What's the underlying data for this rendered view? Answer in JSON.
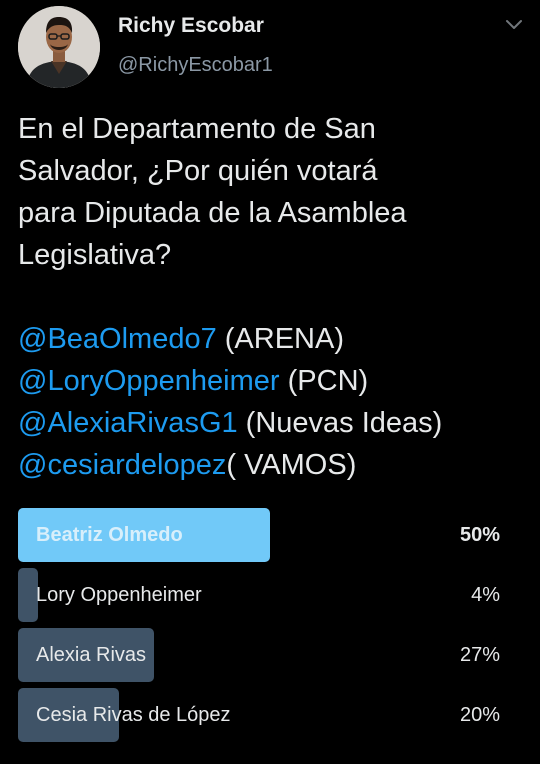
{
  "author": {
    "name": "Richy Escobar",
    "handle": "@RichyEscobar1",
    "avatar_icon": "profile-photo"
  },
  "tweet": {
    "lines": [
      "En el Departamento de San",
      "Salvador, ¿Por quién votará",
      "para Diputada de la Asamblea",
      "Legislativa?"
    ],
    "mentions": [
      {
        "handle": "@BeaOlmedo7",
        "party": " (ARENA)"
      },
      {
        "handle": "@LoryOppenheimer",
        "party": " (PCN)"
      },
      {
        "handle": "@AlexiaRivasG1",
        "party": " (Nuevas Ideas)"
      },
      {
        "handle": "@cesiardelopez",
        "party": "( VAMOS)"
      }
    ]
  },
  "poll": {
    "options": [
      {
        "label": "Beatriz Olmedo",
        "percent_text": "50%",
        "percent": 50,
        "leading": true
      },
      {
        "label": "Lory Oppenheimer",
        "percent_text": "4%",
        "percent": 4,
        "leading": false
      },
      {
        "label": "Alexia Rivas",
        "percent_text": "27%",
        "percent": 27,
        "leading": false
      },
      {
        "label": "Cesia Rivas de López",
        "percent_text": "20%",
        "percent": 20,
        "leading": false
      }
    ]
  },
  "colors": {
    "mention": "#1d9bf0",
    "leading_bar": "#71c9f8",
    "bar": "#3f5367"
  }
}
